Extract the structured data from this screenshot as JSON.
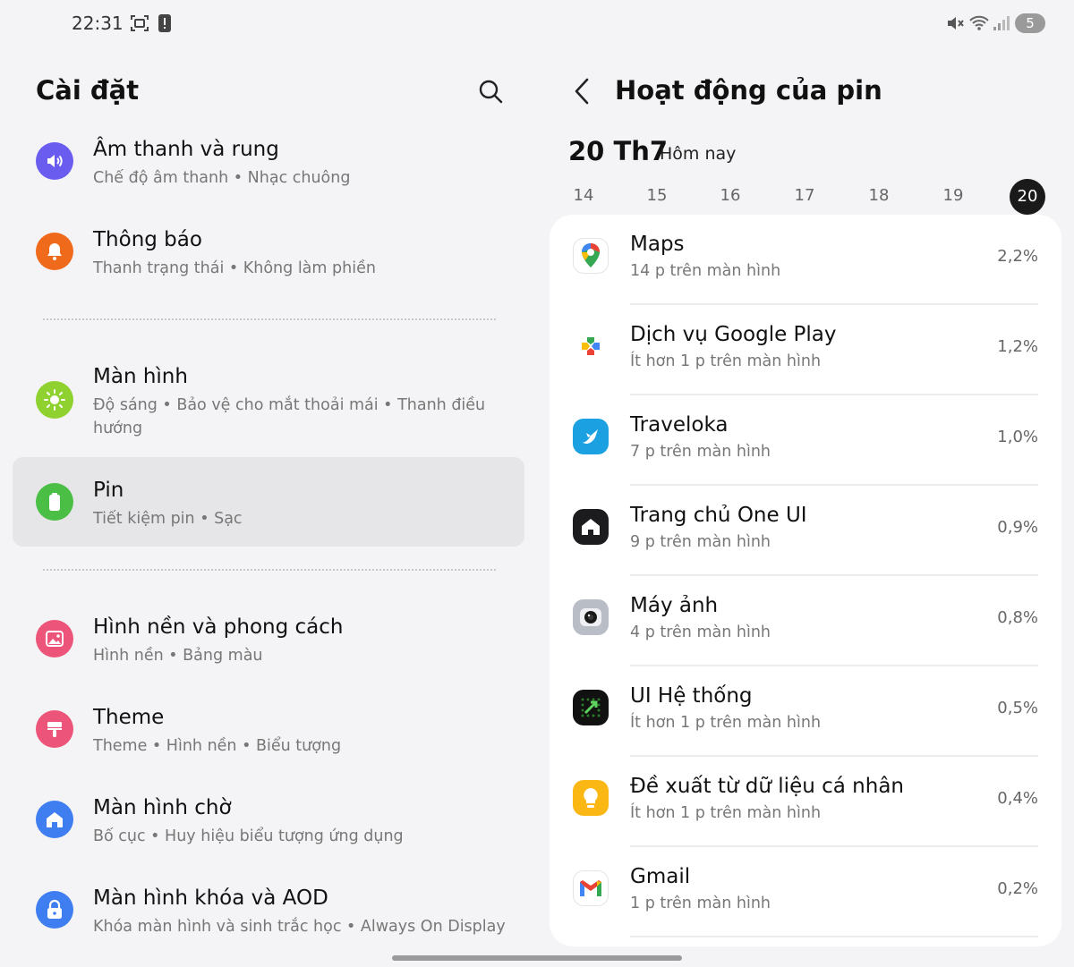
{
  "status_bar": {
    "time": "22:31",
    "notification_count": "5"
  },
  "settings": {
    "title": "Cài đặt",
    "items": [
      {
        "title": "Âm thanh và rung",
        "subtitle": "Chế độ âm thanh • Nhạc chuông",
        "icon": "sound-icon",
        "color": "#6b5cf0"
      },
      {
        "title": "Thông báo",
        "subtitle": "Thanh trạng thái • Không làm phiền",
        "icon": "bell-icon",
        "color": "#f06a1c"
      },
      {
        "title": "Màn hình",
        "subtitle": "Độ sáng • Bảo vệ cho mắt thoải mái • Thanh điều hướng",
        "icon": "brightness-icon",
        "color": "#8fd12e"
      },
      {
        "title": "Pin",
        "subtitle": "Tiết kiệm pin • Sạc",
        "icon": "battery-icon",
        "color": "#4bbf45"
      },
      {
        "title": "Hình nền và phong cách",
        "subtitle": "Hình nền • Bảng màu",
        "icon": "wallpaper-icon",
        "color": "#ec5479"
      },
      {
        "title": "Theme",
        "subtitle": "Theme • Hình nền • Biểu tượng",
        "icon": "theme-brush-icon",
        "color": "#ec5479"
      },
      {
        "title": "Màn hình chờ",
        "subtitle": "Bố cục • Huy hiệu biểu tượng ứng dụng",
        "icon": "home-screen-icon",
        "color": "#3f7ef0"
      },
      {
        "title": "Màn hình khóa và AOD",
        "subtitle": "Khóa màn hình và sinh trắc học • Always On Display",
        "icon": "lock-icon",
        "color": "#3f7ef0"
      }
    ]
  },
  "battery": {
    "title": "Hoạt động của pin",
    "date": "20 Th7",
    "date_label": "Hôm nay",
    "days": [
      "14",
      "15",
      "16",
      "17",
      "18",
      "19",
      "20"
    ],
    "selected_day": "20",
    "apps": [
      {
        "name": "Maps",
        "time": "14 p trên màn hình",
        "percent": "2,2%",
        "icon": "maps-icon"
      },
      {
        "name": "Dịch vụ Google Play",
        "time": "Ít hơn 1 p trên màn hình",
        "percent": "1,2%",
        "icon": "google-play-services-icon"
      },
      {
        "name": "Traveloka",
        "time": "7 p trên màn hình",
        "percent": "1,0%",
        "icon": "traveloka-icon"
      },
      {
        "name": "Trang chủ One UI",
        "time": "9 p trên màn hình",
        "percent": "0,9%",
        "icon": "one-ui-home-icon"
      },
      {
        "name": "Máy ảnh",
        "time": "4 p trên màn hình",
        "percent": "0,8%",
        "icon": "camera-icon"
      },
      {
        "name": "UI Hệ thống",
        "time": "Ít hơn 1 p trên màn hình",
        "percent": "0,5%",
        "icon": "system-ui-icon"
      },
      {
        "name": "Đề xuất từ dữ liệu cá nhân",
        "time": "Ít hơn 1 p trên màn hình",
        "percent": "0,4%",
        "icon": "suggestions-bulb-icon"
      },
      {
        "name": "Gmail",
        "time": "1 p trên màn hình",
        "percent": "0,2%",
        "icon": "gmail-icon"
      }
    ]
  }
}
